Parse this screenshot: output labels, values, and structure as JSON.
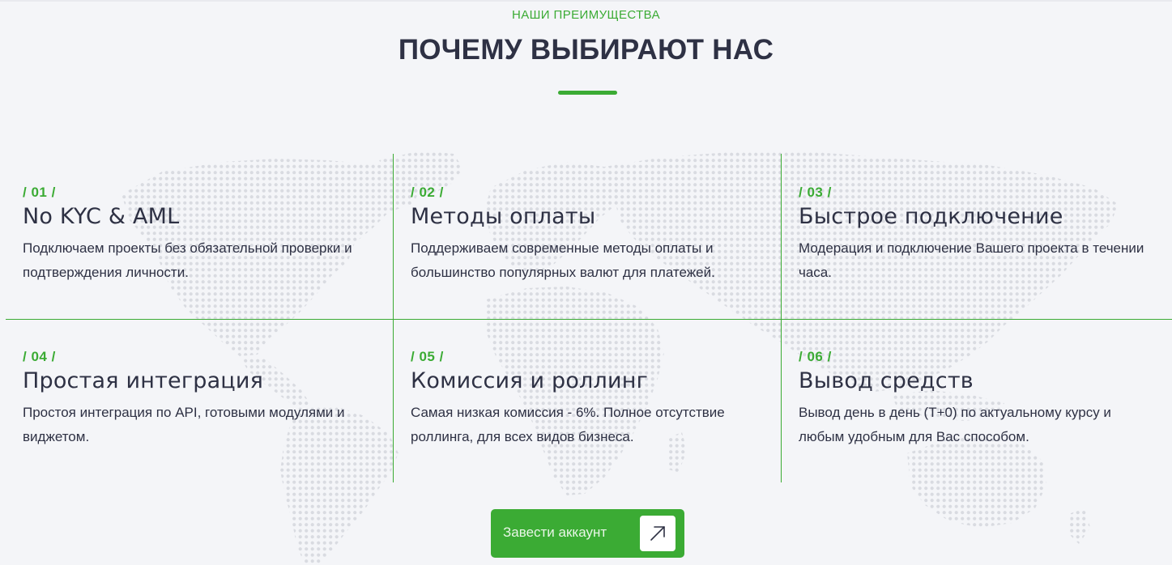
{
  "header": {
    "kicker": "НАШИ ПРЕИМУЩЕСТВА",
    "title": "ПОЧЕМУ ВЫБИРАЮТ НАС"
  },
  "features": [
    {
      "num": "/ 01 /",
      "title": "No KYC & AML",
      "desc": "Подключаем проекты без обязательной проверки и подтверждения личности."
    },
    {
      "num": "/ 02 /",
      "title": "Методы оплаты",
      "desc": "Поддерживаем современные методы оплаты и большинство популярных валют для платежей."
    },
    {
      "num": "/ 03 /",
      "title": "Быстрое подключение",
      "desc": "Модерация и подключение Вашего проекта в течении часа."
    },
    {
      "num": "/ 04 /",
      "title": "Простая интеграция",
      "desc": "Простоя интеграция по API, готовыми модулями и виджетом."
    },
    {
      "num": "/ 05 /",
      "title": "Комиссия и роллинг",
      "desc": "Самая низкая комиссия - 6%. Полное отсутствие роллинга, для всех видов бизнеса."
    },
    {
      "num": "/ 06 /",
      "title": "Вывод средств",
      "desc": "Вывод день в день (T+0) по актуальному курсу и любым удобным для Вас способом."
    }
  ],
  "cta": {
    "label": "Завести аккаунт",
    "icon": "arrow-up-right-icon"
  },
  "colors": {
    "accent": "#3bab34",
    "text": "#2e3144",
    "background": "#f4f5f8"
  }
}
